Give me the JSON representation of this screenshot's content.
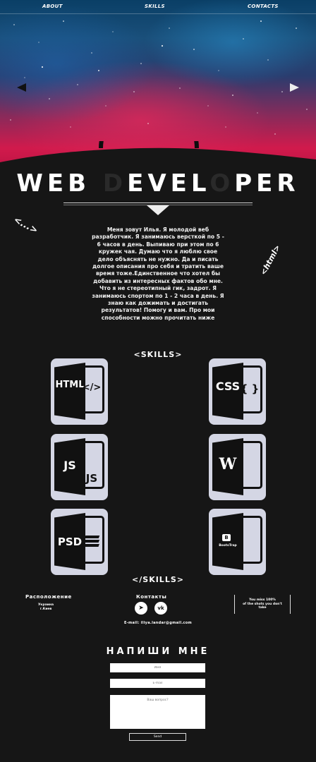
{
  "nav": {
    "about": "ABOUT",
    "skills": "SKILLS",
    "contacts": "CONTACTS"
  },
  "hero": {
    "title_parts": [
      "WEB ",
      "D",
      "EVEL",
      "O",
      "PER"
    ]
  },
  "deco": {
    "left": "<...>",
    "right": "<html>"
  },
  "about_text": "Меня зовут Илья. Я молодой веб разработчик. Я занимаюсь версткой по 5 - 6 часов в день. Выпиваю при этом по 6 кружек чая. Думаю что я люблю свое дело объяснять не нужно. Да и писать долгое описания про себя и тратить ваше время тоже.Единственное что хотел бы добавить из интересных фактов обо мне. Что я не стереотипный гик, задрот. Я занимаюсь спортом по 1 - 2 часа в день. Я знаю как дожимать и достигать результатов! Помогу и вам. Про мои способности можно прочитать ниже",
  "skills_header": "<SKILLS>",
  "skills_footer": "</SKILLS>",
  "skills": [
    {
      "big": "HTML",
      "small": "</>",
      "icon": "html-icon"
    },
    {
      "big": "CSS",
      "small": "{ }",
      "icon": "css-icon"
    },
    {
      "big": "JS",
      "small": "JS",
      "icon": "js-icon"
    },
    {
      "big": "W",
      "small": "",
      "icon": "word-icon"
    },
    {
      "big": "PSD",
      "small": "",
      "icon": "psd-icon"
    },
    {
      "big": "BootsTrap",
      "small": "",
      "icon": "bootstrap-icon"
    }
  ],
  "footer": {
    "location_heading": "Расположение",
    "location_country": "Украина",
    "location_city": "г.Киев",
    "contacts_heading": "Контакты",
    "email": "E-mail: iliya.landar@gmail.com",
    "quote_line1": "You miss 100%",
    "quote_line2": "of the shots you don't",
    "quote_line3": "take"
  },
  "form": {
    "heading": "НАПИШИ МНЕ",
    "name_placeholder": "Имя",
    "email_placeholder": "E-mail",
    "message_placeholder": "Ваш вопрос?",
    "send_label": "Send"
  },
  "colors": {
    "background": "#161616",
    "card": "#d4d6e4",
    "accent_red": "#d11a4c",
    "sky_blue": "#0a3f66"
  }
}
